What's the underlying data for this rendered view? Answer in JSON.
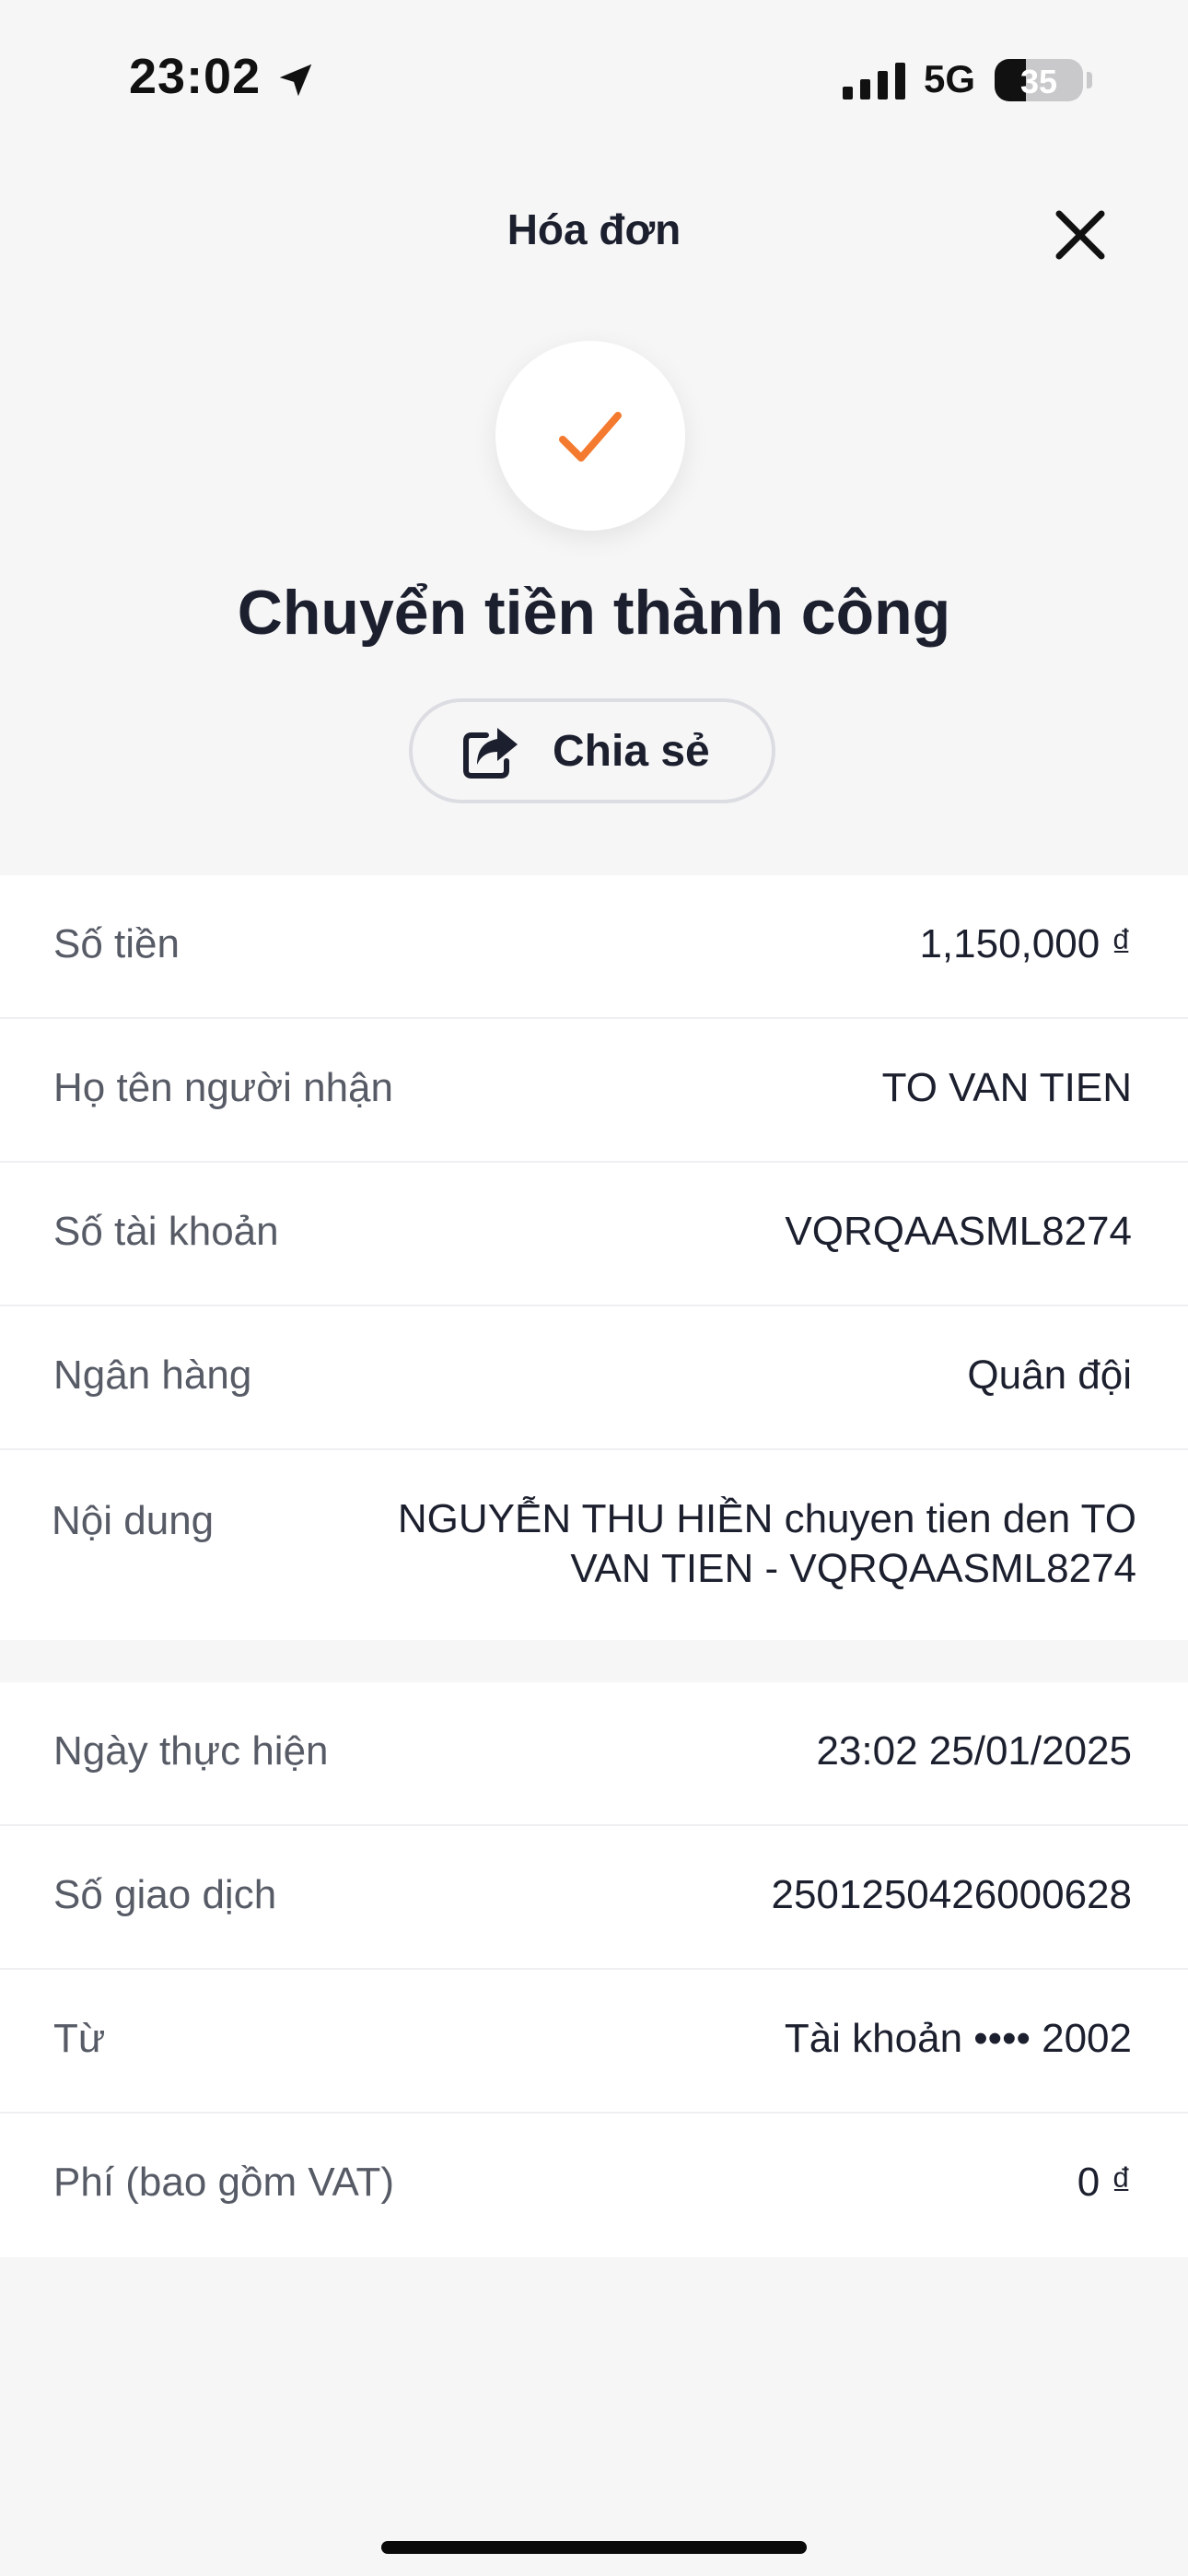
{
  "status_bar": {
    "time": "23:02",
    "network": "5G",
    "battery": "35"
  },
  "header": {
    "title": "Hóa đơn"
  },
  "result": {
    "title": "Chuyển tiền thành công",
    "share_label": "Chia sẻ"
  },
  "details": [
    {
      "label": "Số tiền",
      "value": "1,150,000 ₫"
    },
    {
      "label": "Họ tên người nhận",
      "value": "TO VAN TIEN"
    },
    {
      "label": "Số tài khoản",
      "value": "VQRQAASML8274"
    },
    {
      "label": "Ngân hàng",
      "value": "Quân đội"
    },
    {
      "label": "Nội dung",
      "value": "NGUYỄN THU HIỀN chuyen tien den TO VAN TIEN - VQRQAASML8274"
    }
  ],
  "transaction": [
    {
      "label": "Ngày thực hiện",
      "value": "23:02 25/01/2025"
    },
    {
      "label": "Số giao dịch",
      "value": "2501250426000628"
    },
    {
      "label": "Từ",
      "value": "Tài khoản •••• 2002"
    },
    {
      "label": "Phí (bao gồm VAT)",
      "value": "0 ₫"
    }
  ],
  "icons": {
    "location": "location-arrow-icon",
    "signal": "cellular-signal-icon",
    "close": "close-icon",
    "check": "checkmark-icon",
    "share": "share-icon"
  },
  "colors": {
    "accent": "#f47a2f",
    "text": "#1c1f2e",
    "label": "#575b66",
    "background": "#f6f6f7"
  }
}
